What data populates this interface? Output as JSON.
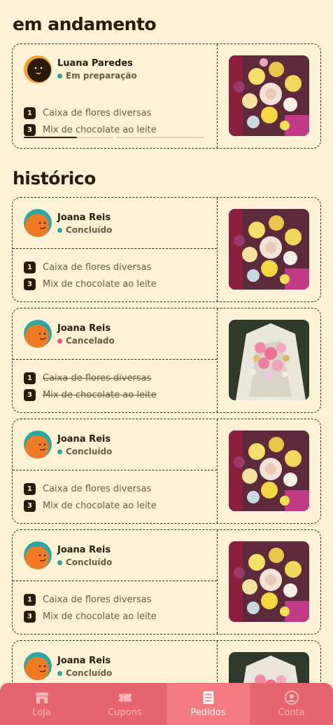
{
  "sections": {
    "in_progress_title": "em andamento",
    "history_title": "histórico"
  },
  "colors": {
    "background": "#fdf1d6",
    "nav_bg": "#e5646d",
    "nav_active": "#f27a80",
    "status_ok": "#2aa7a0",
    "status_cancel": "#e8566a"
  },
  "current_order": {
    "name": "Luana Paredes",
    "status": "Em preparação",
    "progress_steps": 2,
    "progress_done": 0.5,
    "items": [
      {
        "qty": "1",
        "label": "Caixa de flores diversas"
      },
      {
        "qty": "3",
        "label": "Mix de chocolate ao leite"
      }
    ]
  },
  "history": [
    {
      "name": "Joana Reis",
      "status": "Concluído",
      "items": [
        {
          "qty": "1",
          "label": "Caixa de flores diversas"
        },
        {
          "qty": "3",
          "label": "Mix de chocolate ao leite"
        }
      ]
    },
    {
      "name": "Joana Reis",
      "status": "Cancelado",
      "items": [
        {
          "qty": "1",
          "label": "Caixa de flores diversas"
        },
        {
          "qty": "3",
          "label": "Mix de chocolate ao leite"
        }
      ]
    },
    {
      "name": "Joana Reis",
      "status": "Concluído",
      "items": [
        {
          "qty": "1",
          "label": "Caixa de flores diversas"
        },
        {
          "qty": "3",
          "label": "Mix de chocolate ao leite"
        }
      ]
    },
    {
      "name": "Joana Reis",
      "status": "Concluído",
      "items": [
        {
          "qty": "1",
          "label": "Caixa de flores diversas"
        },
        {
          "qty": "3",
          "label": "Mix de chocolate ao leite"
        }
      ]
    },
    {
      "name": "Joana Reis",
      "status": "Concluído"
    }
  ],
  "nav": {
    "items": [
      {
        "label": "Loja",
        "icon": "store-icon"
      },
      {
        "label": "Cupons",
        "icon": "ticket-icon"
      },
      {
        "label": "Pedidos",
        "icon": "receipt-icon"
      },
      {
        "label": "Conta",
        "icon": "account-icon"
      }
    ],
    "active": "Pedidos"
  }
}
